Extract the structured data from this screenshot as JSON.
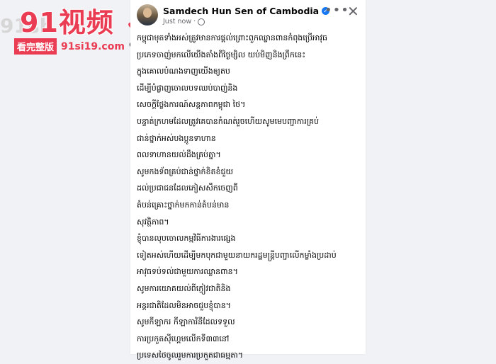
{
  "watermark": {
    "title": "91视频",
    "faded_text": "91sh",
    "badge": "看完整版",
    "url": "91si19.com",
    "search_icon": "magnifier-icon",
    "brand_color": "#ea3c53"
  },
  "post": {
    "author": "Samdech Hun Sen of Cambodia",
    "timestamp": "Just now",
    "verified_icon": "verified-check-icon",
    "privacy_icon": "globe-icon",
    "more_label": "•••",
    "close_label": "✕",
    "lines": [
      "កម្ពុជាមុតទាំងអស់ត្រូវមានការផ្ដល់ព្រោះពួកឈ្លានពានកំពុងប្រើអាវុធ",
      "ប្រភេទចាញ់មកលើយើងតាំងពីថ្ងៃម្សិល យប់មិញនិងព្រឹកនេះ",
      "ក្នុងគោលបំណងទាញយើងឲ្យតប",
      "ដើម្បីបំផ្លាញចោលបទឈប់បាញ់និង",
      "សេចក្តីថ្លែងការណ៍សន្តភាពកម្ពុជា ថៃ។",
      "បន្ទាត់ក្រហមដែលត្រូវគេបានកំណត់រួចហើយសូមមេបញ្ជាការគ្រប់",
      "ជាន់ថ្នាក់អស់បងប្អូនទាហាន",
      "ពលទាហានយល់ដឹងគ្រប់គ្នា។",
      "សូមកងទ័ពគ្រប់ជាន់ថ្នាក់ខិតខំជួយ",
      "ដល់ប្រជាជនដែលភៀសសឹកចេញពី",
      "តំបន់គ្រោះថ្នាក់មកកាន់តំបន់មាន",
      "សុវត្ថិភាព។",
      "ខ្ញុំបានលុបចោលកម្មវិធីការងារផ្សេង",
      "ទៀតអស់ហើយដើម្បីមកបុកជាមួយនាយករដ្ឋមន្ត្រីបញ្ជាលើកម្លាំងប្រដាប់",
      "អាវុធទប់ទល់ជាមួយការឈ្លានពាន។",
      "សូមការយោគយល់ពីភ្ញៀវជាតិនិង",
      "អន្តរជាតិដែលមិនអាចជួបខ្ញុំបាន។",
      "សូមកីឡាករ កីឡាការិនីដែលទទួល",
      "ការប្រកួតស៊ីហ្គេមលើកទី៣៣នៅ",
      "ប្រទេសថៃចូលរួមការប្រកួតជាធម្មតា។"
    ]
  }
}
